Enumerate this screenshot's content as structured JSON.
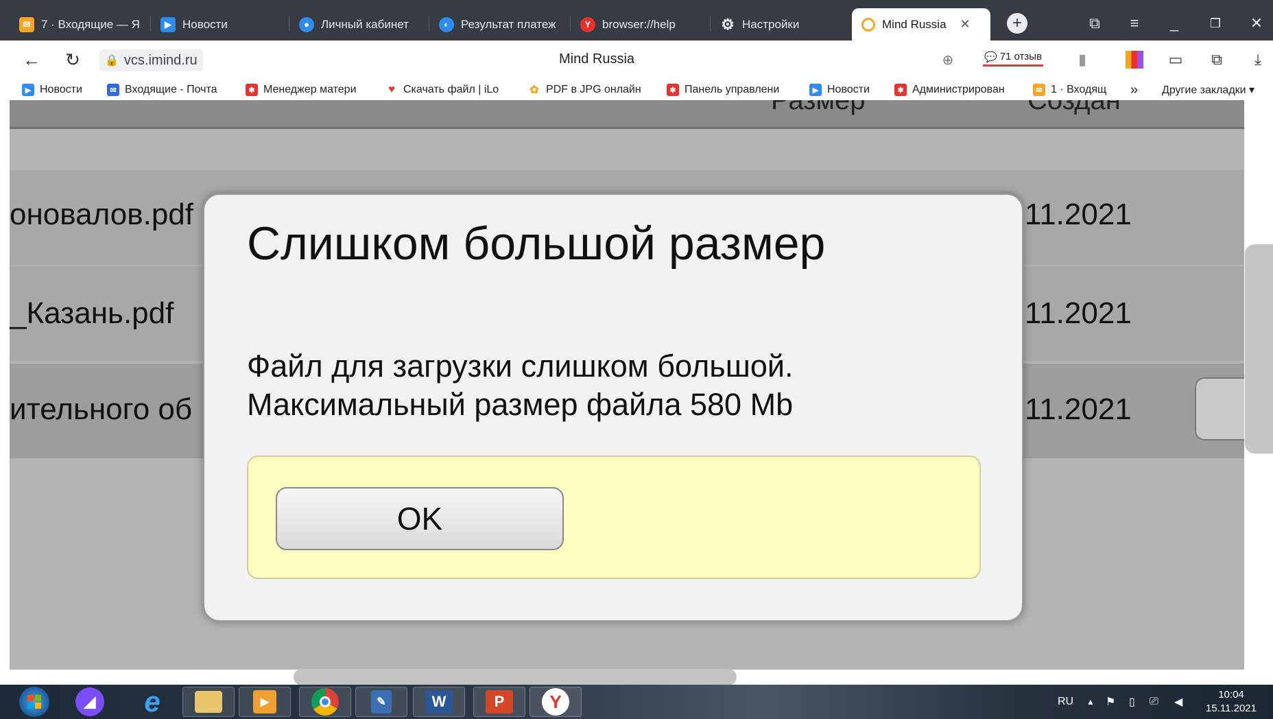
{
  "browser": {
    "tabs": [
      {
        "title": "7 · Входящие — Я",
        "icon": "mail-icon",
        "color": "#f5a623"
      },
      {
        "title": "Новости",
        "icon": "news-icon",
        "color": "#2d8cf0"
      },
      {
        "title": "Личный кабинет",
        "icon": "cabinet-icon",
        "color": "#2d8cf0"
      },
      {
        "title": "Результат платеж",
        "icon": "payment-icon",
        "color": "#2d8cf0"
      },
      {
        "title": "browser://help",
        "icon": "yandex-icon",
        "color": "#e8322b"
      },
      {
        "title": "Настройки",
        "icon": "gear-icon",
        "color": "#cccccc"
      },
      {
        "title": "Mind Russia",
        "icon": "mind-icon",
        "color": "#f5a623"
      }
    ],
    "new_tab_symbol": "+",
    "window_controls": {
      "tabs_list": "⧉",
      "menu": "≡",
      "minimize": "_",
      "restore": "🗗",
      "close": "✕"
    },
    "address": {
      "url": "vcs.imind.ru",
      "page_title": "Mind Russia",
      "reviews": "71 отзыв"
    },
    "bookmarks": [
      {
        "label": "Новости",
        "icon": "news-icon",
        "color": "#2d8cf0"
      },
      {
        "label": "Входящие - Почта",
        "icon": "mail-icon",
        "color": "#2d6cdf"
      },
      {
        "label": "Менеджер матери",
        "icon": "joomla-icon",
        "color": "#e8322b"
      },
      {
        "label": "Скачать файл | iLo",
        "icon": "heart-icon",
        "color": "#e8322b"
      },
      {
        "label": "PDF в JPG онлайн",
        "icon": "pdf-icon",
        "color": "#f5a623"
      },
      {
        "label": "Панель управлени",
        "icon": "joomla-icon",
        "color": "#e8322b"
      },
      {
        "label": "Новости",
        "icon": "news-icon",
        "color": "#2d8cf0"
      },
      {
        "label": "Администрирован",
        "icon": "joomla-icon",
        "color": "#e8322b"
      },
      {
        "label": "1 · Входящ",
        "icon": "mail-icon",
        "color": "#f5a623"
      }
    ],
    "more_bookmarks": "»",
    "other_bookmarks": "Другие закладки ▾"
  },
  "page": {
    "header_columns": [
      "Размер",
      "Создан"
    ],
    "rows": [
      {
        "name": "оновалов.pdf",
        "date": "11.2021"
      },
      {
        "name": "_Казань.pdf",
        "date": "11.2021"
      },
      {
        "name": "ительного об",
        "date": "11.2021"
      }
    ]
  },
  "modal": {
    "title": "Слишком большой размер",
    "line1": "Файл для загрузки слишком большой.",
    "line2": "Максимальный размер файла 580 Mb",
    "ok_label": "OK"
  },
  "taskbar": {
    "apps": [
      "start",
      "alice",
      "internet-explorer",
      "file-explorer",
      "media-player",
      "chrome",
      "app",
      "word",
      "powerpoint",
      "yandex-browser"
    ],
    "language": "RU",
    "time": "10:04",
    "date": "15.11.2021"
  }
}
